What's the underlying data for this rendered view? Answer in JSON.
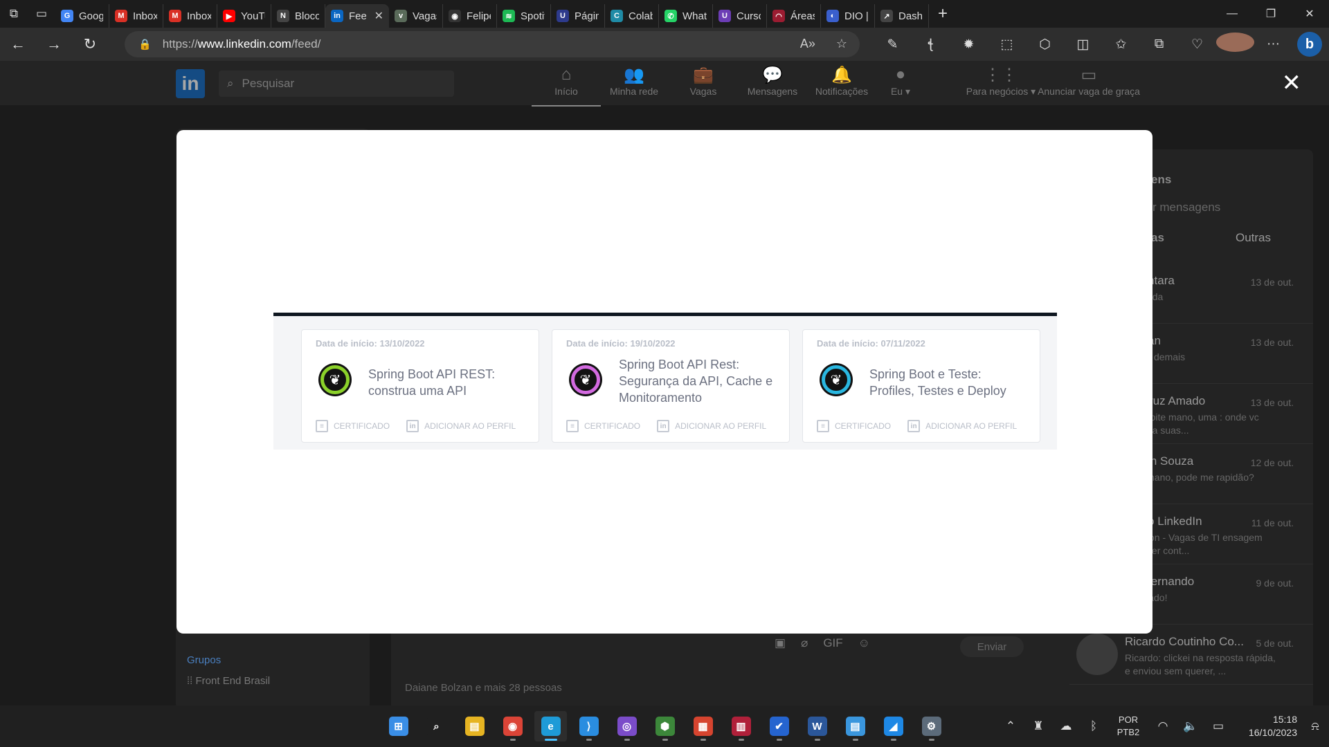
{
  "browser": {
    "tabs": [
      {
        "label": "Google",
        "color": "#4285f4",
        "icon": "google-icon",
        "glyph": "G"
      },
      {
        "label": "Inbox (",
        "color": "#d93025",
        "icon": "gmail-icon",
        "glyph": "M"
      },
      {
        "label": "Inbox (",
        "color": "#d93025",
        "icon": "gmail-icon",
        "glyph": "M"
      },
      {
        "label": "YouTub",
        "color": "#ff0000",
        "icon": "youtube-icon",
        "glyph": "▶"
      },
      {
        "label": "Bloco d",
        "color": "#444444",
        "icon": "notion-icon",
        "glyph": "N"
      },
      {
        "label": "Fee",
        "color": "#0a66c2",
        "icon": "linkedin-icon",
        "glyph": "in",
        "active": true
      },
      {
        "label": "Vagas r",
        "color": "#5a6b5a",
        "icon": "vagas-icon",
        "glyph": "v"
      },
      {
        "label": "Felipe I",
        "color": "#333333",
        "icon": "github-icon",
        "glyph": "◉"
      },
      {
        "label": "Spotify",
        "color": "#1db954",
        "icon": "spotify-icon",
        "glyph": "≋"
      },
      {
        "label": "Página",
        "color": "#2d3a8c",
        "icon": "page-icon",
        "glyph": "U"
      },
      {
        "label": "Colabor",
        "color": "#1f8ba6",
        "icon": "colab-icon",
        "glyph": "C"
      },
      {
        "label": "WhatsA",
        "color": "#25d366",
        "icon": "whatsapp-icon",
        "glyph": "✆"
      },
      {
        "label": "Cursos",
        "color": "#6c3db5",
        "icon": "cursos-icon",
        "glyph": "U"
      },
      {
        "label": "Áreas d",
        "color": "#9b1c31",
        "icon": "areas-icon",
        "glyph": "◠"
      },
      {
        "label": "DIO | C",
        "color": "#3a5fcd",
        "icon": "dio-icon",
        "glyph": "◐"
      },
      {
        "label": "Dashbo",
        "color": "#444444",
        "icon": "dashboard-icon",
        "glyph": "↗"
      }
    ],
    "url_prefix": "https://",
    "url_host": "www.linkedin.com",
    "url_path": "/feed/",
    "accent": "#4cc2ff"
  },
  "linkedin": {
    "search_placeholder": "Pesquisar",
    "nav": [
      {
        "label": "Início",
        "icon": "home-icon",
        "glyph": "⌂",
        "active": true
      },
      {
        "label": "Minha rede",
        "icon": "network-icon",
        "glyph": "👥"
      },
      {
        "label": "Vagas",
        "icon": "briefcase-icon",
        "glyph": "💼"
      },
      {
        "label": "Mensagens",
        "icon": "messaging-icon",
        "glyph": "💬"
      },
      {
        "label": "Notificações",
        "icon": "bell-icon",
        "glyph": "🔔"
      },
      {
        "label": "Eu ▾",
        "icon": "avatar-icon",
        "glyph": "●"
      },
      {
        "label": "Para negócios ▾",
        "icon": "grid-icon",
        "glyph": "⋮⋮"
      },
      {
        "label": "Anunciar vaga de graça",
        "icon": "post-job-icon",
        "glyph": "▭"
      }
    ],
    "groups_title": "Grupos",
    "group_item": "Front End Brasil",
    "reactions": "Daiane Bolzan e mais 28 pessoas",
    "messaging": {
      "title": "ens",
      "search_placeholder": "r mensagens",
      "tab_focused": "as",
      "tab_other": "Outras",
      "send_label": "Enviar",
      "conversations": [
        {
          "name": "Alcântara",
          "date": "13 de out.",
          "preview": "por nada"
        },
        {
          "name": "Jordan",
          "date": "13 de out.",
          "preview": "Daora demais"
        },
        {
          "name": "us Cruz Amado",
          "date": "13 de out.",
          "preview": "Boa noite mano, uma : onde vc procura suas..."
        },
        {
          "name": "hoven Souza",
          "date": "12 de out.",
          "preview": "Fala mano, pode me rapidão?"
        },
        {
          "name": "rio do LinkedIn",
          "date": "11 de out.",
          "preview": "Solution - Vagas de TI ensagem pode ter cont..."
        },
        {
          "name": "ldo Fernando",
          "date": "9 de out.",
          "preview": "Obrigado!"
        },
        {
          "name": "Ricardo Coutinho Co...",
          "date": "5 de out.",
          "preview": "Ricardo: clickei na resposta rápida, e enviou sem querer, ..."
        }
      ]
    }
  },
  "modal": {
    "certificates": [
      {
        "date": "Data de início: 13/10/2022",
        "title": "Spring Boot API REST: construa uma API",
        "ring_color": "#8bd12a",
        "certificate_label": "CERTIFICADO",
        "profile_label": "ADICIONAR AO PERFIL"
      },
      {
        "date": "Data de início: 19/10/2022",
        "title": "Spring Boot API Rest: Segurança da API, Cache e Monitoramento",
        "ring_color": "#d36ae0",
        "certificate_label": "CERTIFICADO",
        "profile_label": "ADICIONAR AO PERFIL"
      },
      {
        "date": "Data de início: 07/11/2022",
        "title": "Spring Boot e Teste: Profiles, Testes e Deploy",
        "ring_color": "#2ab7e0",
        "certificate_label": "CERTIFICADO",
        "profile_label": "ADICIONAR AO PERFIL"
      }
    ]
  },
  "taskbar": {
    "apps": [
      {
        "name": "start-icon",
        "glyph": "⊞",
        "color": "#3a8ee6"
      },
      {
        "name": "search-icon",
        "glyph": "⌕",
        "color": "#202020"
      },
      {
        "name": "file-explorer-icon",
        "glyph": "▤",
        "color": "#e6b422"
      },
      {
        "name": "chrome-icon",
        "glyph": "◉",
        "color": "#db4437"
      },
      {
        "name": "edge-icon",
        "glyph": "e",
        "color": "#1e9bd7",
        "active": true
      },
      {
        "name": "vscode-icon",
        "glyph": "⟩",
        "color": "#2a8de0"
      },
      {
        "name": "github-desktop-icon",
        "glyph": "◎",
        "color": "#7b4cc9"
      },
      {
        "name": "nodejs-icon",
        "glyph": "⬢",
        "color": "#3c873a"
      },
      {
        "name": "winget-icon",
        "glyph": "▦",
        "color": "#d6442f"
      },
      {
        "name": "analytics-icon",
        "glyph": "▥",
        "color": "#b0203a"
      },
      {
        "name": "todo-icon",
        "glyph": "✔",
        "color": "#2564cf"
      },
      {
        "name": "word-icon",
        "glyph": "W",
        "color": "#2b579a"
      },
      {
        "name": "notepad-icon",
        "glyph": "▤",
        "color": "#3a96dd"
      },
      {
        "name": "photos-icon",
        "glyph": "◢",
        "color": "#1e88e5"
      },
      {
        "name": "settings-icon",
        "glyph": "⚙",
        "color": "#5c6b7a"
      }
    ],
    "lang_line1": "POR",
    "lang_line2": "PTB2",
    "time": "15:18",
    "date": "16/10/2023"
  }
}
